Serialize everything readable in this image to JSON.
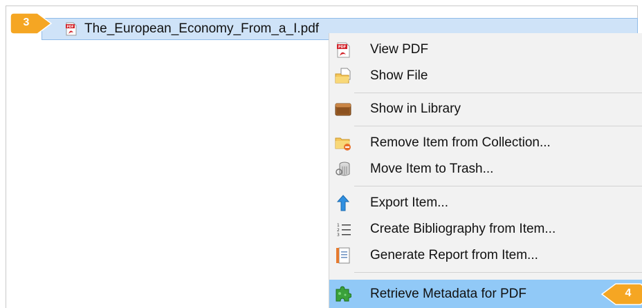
{
  "file": {
    "name": "The_European_Economy_From_a_I.pdf"
  },
  "callouts": {
    "step3": "3",
    "step4": "4"
  },
  "menu": {
    "items": [
      {
        "id": "view-pdf",
        "label": "View PDF",
        "icon": "pdf-icon"
      },
      {
        "id": "show-file",
        "label": "Show File",
        "icon": "folder-file-icon"
      },
      {
        "id": "show-in-library",
        "label": "Show in Library",
        "icon": "library-box-icon"
      },
      {
        "id": "remove-from-collection",
        "label": "Remove Item from Collection...",
        "icon": "folder-remove-icon"
      },
      {
        "id": "move-to-trash",
        "label": "Move Item to Trash...",
        "icon": "trash-icon"
      },
      {
        "id": "export-item",
        "label": "Export Item...",
        "icon": "export-arrow-icon"
      },
      {
        "id": "create-bibliography",
        "label": "Create Bibliography from Item...",
        "icon": "numbered-list-icon"
      },
      {
        "id": "generate-report",
        "label": "Generate Report from Item...",
        "icon": "report-icon"
      },
      {
        "id": "retrieve-metadata",
        "label": "Retrieve Metadata for PDF",
        "icon": "puzzle-icon",
        "highlighted": true
      }
    ]
  },
  "colors": {
    "selection": "#cfe3f8",
    "menu_bg": "#f2f2f2",
    "menu_highlight": "#91c9f7",
    "callout": "#f5a623"
  }
}
